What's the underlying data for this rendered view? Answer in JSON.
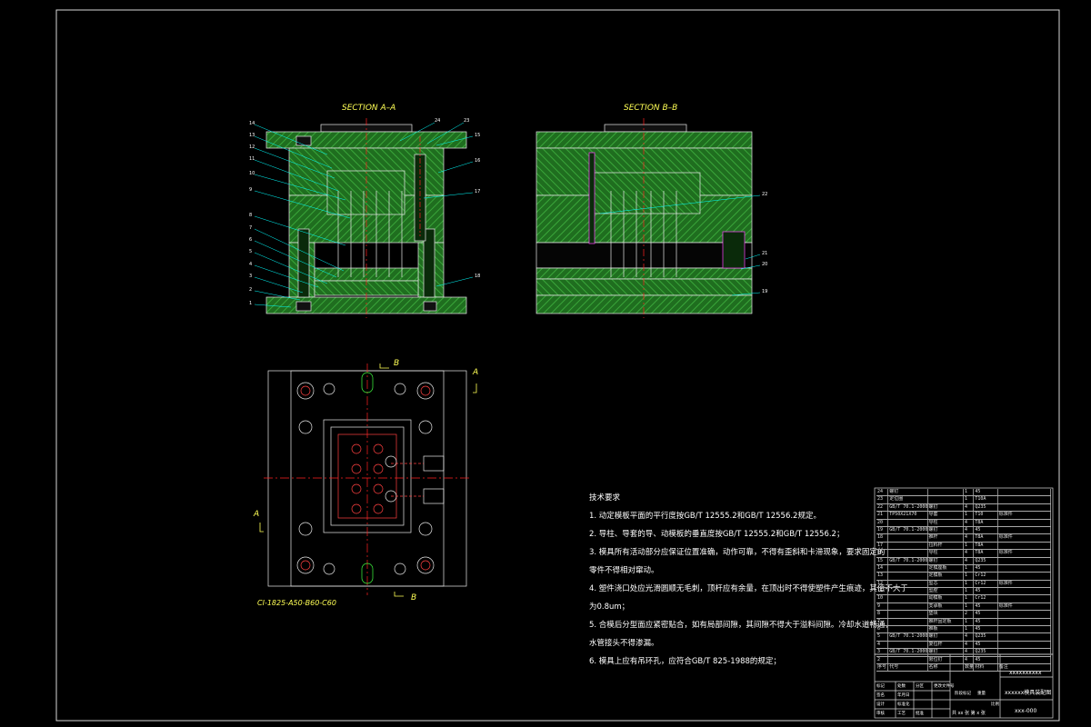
{
  "section_a_title": "SECTION A–A",
  "section_b_title": "SECTION B–B",
  "mold_base_code": "CI-1825-A50-B60-C60",
  "cut_labels": {
    "b_top": "B",
    "b_bottom": "B",
    "a_left": "A",
    "a_right": "A"
  },
  "section_a_numbers": [
    "14",
    "13",
    "12",
    "11",
    "10",
    "9",
    "8",
    "7",
    "6",
    "5",
    "4",
    "3",
    "2",
    "1",
    "24",
    "23",
    "15",
    "16",
    "17",
    "18"
  ],
  "section_b_numbers": [
    "22",
    "21",
    "20",
    "19"
  ],
  "notes": {
    "heading": "技术要求",
    "lines": [
      "1. 动定模板平面的平行度按GB/T 12555.2和GB/T 12556.2规定。",
      "2. 导柱、导套的导、动模板的垂直度按GB/T 12555.2和GB/T 12556.2；",
      "3. 模具所有活动部分应保证位置准确，动作可靠，不得有歪斜和卡滞现象，要求固定的",
      "    零件不得相对窜动。",
      "4. 塑件浇口处应光滑圆顺无毛刺，顶杆应有余量，在顶出时不得使塑件产生痕迹，其值不大于",
      "    为0.8um；",
      "5. 合模后分型面应紧密贴合，如有局部间隙，其间隙不得大于溢料间隙。冷却水道畅通，",
      "    水管接头不得渗漏。",
      "6. 模具上应有吊环孔，应符合GB/T 825-1988的规定；"
    ]
  },
  "bom": {
    "rows": [
      [
        "24",
        "螺钉",
        "",
        "1",
        "45",
        ""
      ],
      [
        "23",
        "定位圈",
        "",
        "1",
        "T10A",
        ""
      ],
      [
        "22",
        "GB/T 70.1-2000",
        "螺钉",
        "4",
        "Q235",
        ""
      ],
      [
        "21",
        "TP50X21X70",
        "导套",
        "1",
        "T10",
        "标准件"
      ],
      [
        "20",
        "",
        "导柱",
        "4",
        "T8A",
        ""
      ],
      [
        "19",
        "GB/T 70.1-2000",
        "螺钉",
        "4",
        "45",
        ""
      ],
      [
        "18",
        "",
        "推杆",
        "4",
        "T8A",
        "标准件"
      ],
      [
        "17",
        "",
        "拉料杆",
        "1",
        "T8A",
        ""
      ],
      [
        "16",
        "",
        "导柱",
        "4",
        "T8A",
        "标准件"
      ],
      [
        "15",
        "GB/T 70.1-2000",
        "螺钉",
        "4",
        "Q235",
        ""
      ],
      [
        "14",
        "",
        "定模座板",
        "1",
        "45",
        ""
      ],
      [
        "13",
        "",
        "定模板",
        "1",
        "Cr12",
        ""
      ],
      [
        "12",
        "",
        "型芯",
        "1",
        "Cr12",
        "标准件"
      ],
      [
        "11",
        "",
        "型腔",
        "1",
        "45",
        ""
      ],
      [
        "10",
        "",
        "动模板",
        "1",
        "Cr12",
        ""
      ],
      [
        "9",
        "",
        "支承板",
        "1",
        "45",
        "标准件"
      ],
      [
        "8",
        "",
        "垫块",
        "2",
        "45",
        ""
      ],
      [
        "7",
        "",
        "推杆固定板",
        "1",
        "45",
        ""
      ],
      [
        "6",
        "",
        "推板",
        "1",
        "45",
        ""
      ],
      [
        "5",
        "GB/T 70.1-2000",
        "螺钉",
        "4",
        "Q235",
        ""
      ],
      [
        "4",
        "",
        "复位杆",
        "4",
        "45",
        ""
      ],
      [
        "3",
        "GB/T 70.1-2000",
        "螺钉",
        "4",
        "Q235",
        ""
      ],
      [
        "2",
        "",
        "限位钉",
        "4",
        "45",
        ""
      ]
    ],
    "header": [
      "序号",
      "代号",
      "名称",
      "数量",
      "材料",
      "备注"
    ]
  },
  "title_block": {
    "project": "xxxxxxxxxx",
    "drawing_title": "xxxxxx模具装配图",
    "scale_sheet": "共 xx 张  第 x 张",
    "drawing_no": "xxx-000",
    "fields": [
      "标记",
      "处数",
      "分区",
      "更改文件号",
      "签名",
      "年月日",
      "设计",
      "标准化",
      "审核",
      "工艺",
      "批准",
      "阶段标记",
      "重量",
      "比例"
    ]
  },
  "colors": {
    "background": "#000000",
    "hatch": "#2e8b2e",
    "outline": "#e8e8e8",
    "centerline": "#ff2020",
    "label": "#ffff55",
    "accent_cyan": "#00ffff",
    "accent_magenta": "#ff40ff"
  }
}
